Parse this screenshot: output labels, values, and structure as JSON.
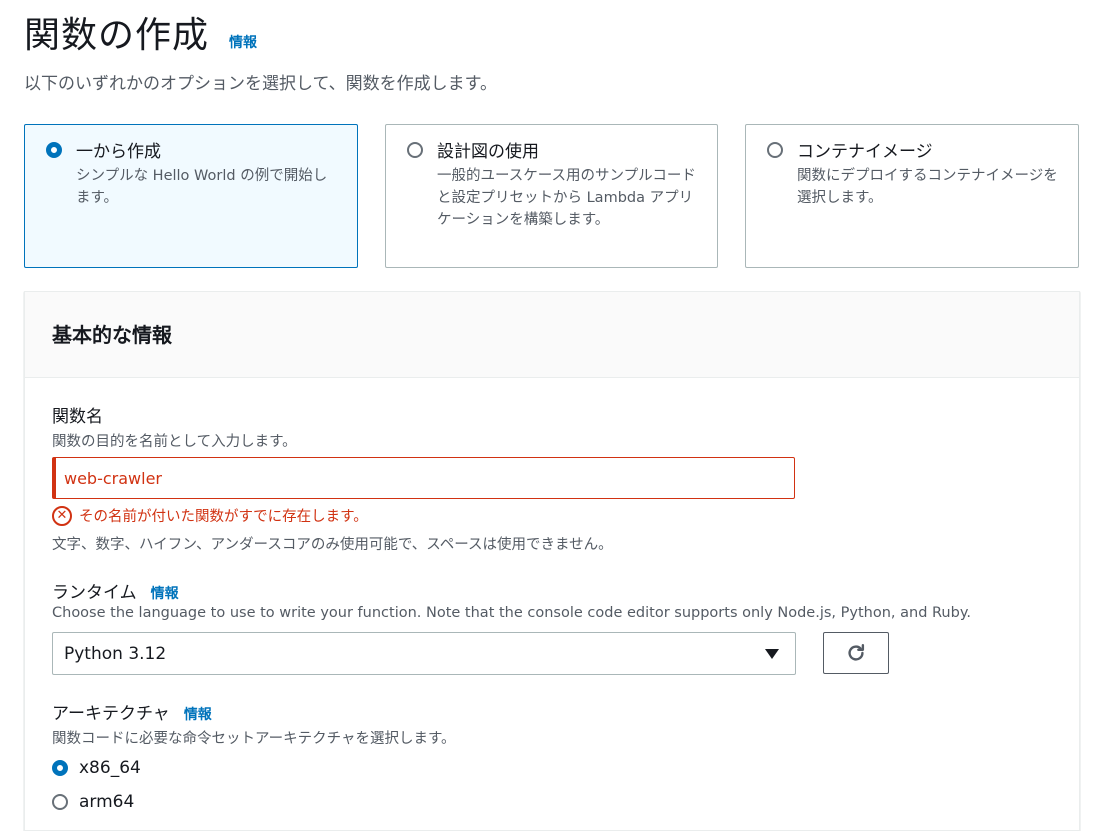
{
  "header": {
    "title": "関数の作成",
    "info": "情報",
    "subtitle": "以下のいずれかのオプションを選択して、関数を作成します。"
  },
  "options": [
    {
      "title": "一から作成",
      "desc": "シンプルな Hello World の例で開始します。",
      "selected": true
    },
    {
      "title": "設計図の使用",
      "desc": "一般的ユースケース用のサンプルコードと設定プリセットから Lambda アプリケーションを構築します。",
      "selected": false
    },
    {
      "title": "コンテナイメージ",
      "desc": "関数にデプロイするコンテナイメージを選択します。",
      "selected": false
    }
  ],
  "basic": {
    "title": "基本的な情報",
    "function_name": {
      "label": "関数名",
      "desc": "関数の目的を名前として入力します。",
      "value": "web-crawler",
      "error": "その名前が付いた関数がすでに存在します。",
      "constraint": "文字、数字、ハイフン、アンダースコアのみ使用可能で、スペースは使用できません。"
    },
    "runtime": {
      "label": "ランタイム",
      "info": "情報",
      "desc": "Choose the language to use to write your function. Note that the console code editor supports only Node.js, Python, and Ruby.",
      "value": "Python 3.12"
    },
    "architecture": {
      "label": "アーキテクチャ",
      "info": "情報",
      "desc": "関数コードに必要な命令セットアーキテクチャを選択します。",
      "options": [
        "x86_64",
        "arm64"
      ],
      "selected": "x86_64"
    }
  },
  "colors": {
    "accent": "#0073bb",
    "error": "#d13212",
    "border": "#aab7b8"
  }
}
